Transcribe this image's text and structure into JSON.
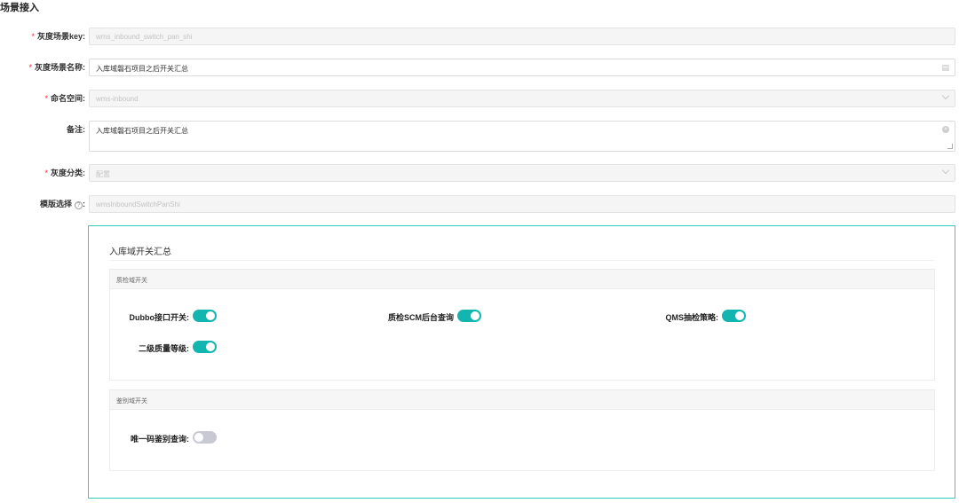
{
  "page": {
    "title": "场景接入"
  },
  "form": {
    "key": {
      "label": "灰度场景key:",
      "value": "wms_inbound_switch_pan_shi"
    },
    "name": {
      "label": "灰度场景名称:",
      "value": "入库域磐石项目之后开关汇总"
    },
    "namespace": {
      "label": "命名空间:",
      "value": "wms-inbound"
    },
    "remark": {
      "label": "备注:",
      "value": "入库域磐石项目之后开关汇总"
    },
    "category": {
      "label": "灰度分类:",
      "value": "配置"
    },
    "template": {
      "label": "模版选择",
      "help": "?",
      "colon": ":",
      "value": "wmsInboundSwitchPanShi"
    }
  },
  "panel": {
    "title": "入库域开关汇总",
    "groups": [
      {
        "title": "质检域开关",
        "switches": [
          {
            "label": "Dubbo接口开关:",
            "on": true
          },
          {
            "label": "质检SCM后台查询",
            "on": true
          },
          {
            "label": "QMS抽检策略:",
            "on": true
          },
          {
            "label": "二级质量等级:",
            "on": true
          }
        ]
      },
      {
        "title": "鉴别域开关",
        "switches": [
          {
            "label": "唯一码鉴别查询:",
            "on": false
          }
        ]
      }
    ]
  },
  "colors": {
    "accent": "#12b5b0",
    "border": "#3cc7bd",
    "required": "#f5222d"
  }
}
